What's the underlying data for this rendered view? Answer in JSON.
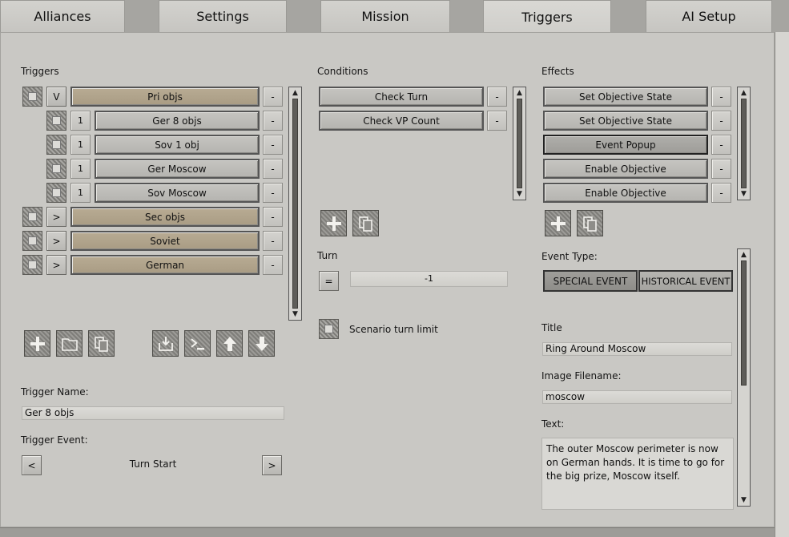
{
  "tabs": [
    {
      "label": "Alliances"
    },
    {
      "label": "Settings"
    },
    {
      "label": "Mission"
    },
    {
      "label": "Triggers"
    },
    {
      "label": "AI Setup"
    }
  ],
  "active_tab": "Triggers",
  "triggers": {
    "heading": "Triggers",
    "rows": [
      {
        "toggle": "V",
        "label": "Pri objs",
        "remove": "-"
      },
      {
        "toggle": "1",
        "label": "Ger 8 objs",
        "remove": "-"
      },
      {
        "toggle": "1",
        "label": "Sov 1 obj",
        "remove": "-"
      },
      {
        "toggle": "1",
        "label": "Ger Moscow",
        "remove": "-"
      },
      {
        "toggle": "1",
        "label": "Sov Moscow",
        "remove": "-"
      },
      {
        "toggle": ">",
        "label": "Sec objs",
        "remove": "-"
      },
      {
        "toggle": ">",
        "label": "Soviet",
        "remove": "-"
      },
      {
        "toggle": ">",
        "label": "German",
        "remove": "-"
      }
    ],
    "name_label": "Trigger Name:",
    "name_value": "Ger 8 objs",
    "event_label": "Trigger Event:",
    "event_prev": "<",
    "event_value": "Turn Start",
    "event_next": ">"
  },
  "conditions": {
    "heading": "Conditions",
    "rows": [
      {
        "label": "Check Turn",
        "remove": "-"
      },
      {
        "label": "Check VP Count",
        "remove": "-"
      }
    ],
    "turn_label": "Turn",
    "turn_operator": "=",
    "turn_value": "-1",
    "scenario_limit_label": "Scenario turn limit"
  },
  "effects": {
    "heading": "Effects",
    "rows": [
      {
        "label": "Set Objective State",
        "remove": "-"
      },
      {
        "label": "Set Objective State",
        "remove": "-"
      },
      {
        "label": "Event Popup",
        "remove": "-"
      },
      {
        "label": "Enable Objective",
        "remove": "-"
      },
      {
        "label": "Enable Objective",
        "remove": "-"
      }
    ],
    "event_type_label": "Event Type:",
    "event_types": [
      "SPECIAL EVENT",
      "HISTORICAL EVENT"
    ],
    "title_label": "Title",
    "title_value": "Ring Around Moscow",
    "image_label": "Image Filename:",
    "image_value": "moscow",
    "text_label": "Text:",
    "text_value": "The outer Moscow perimeter is now on German hands. It is time to go for the big prize, Moscow itself."
  },
  "icons": {
    "add": "plus-icon",
    "folder": "folder-icon",
    "copy": "copy-icon",
    "import": "import-icon",
    "console": "console-icon",
    "up": "arrow-up-icon",
    "down": "arrow-down-icon"
  }
}
